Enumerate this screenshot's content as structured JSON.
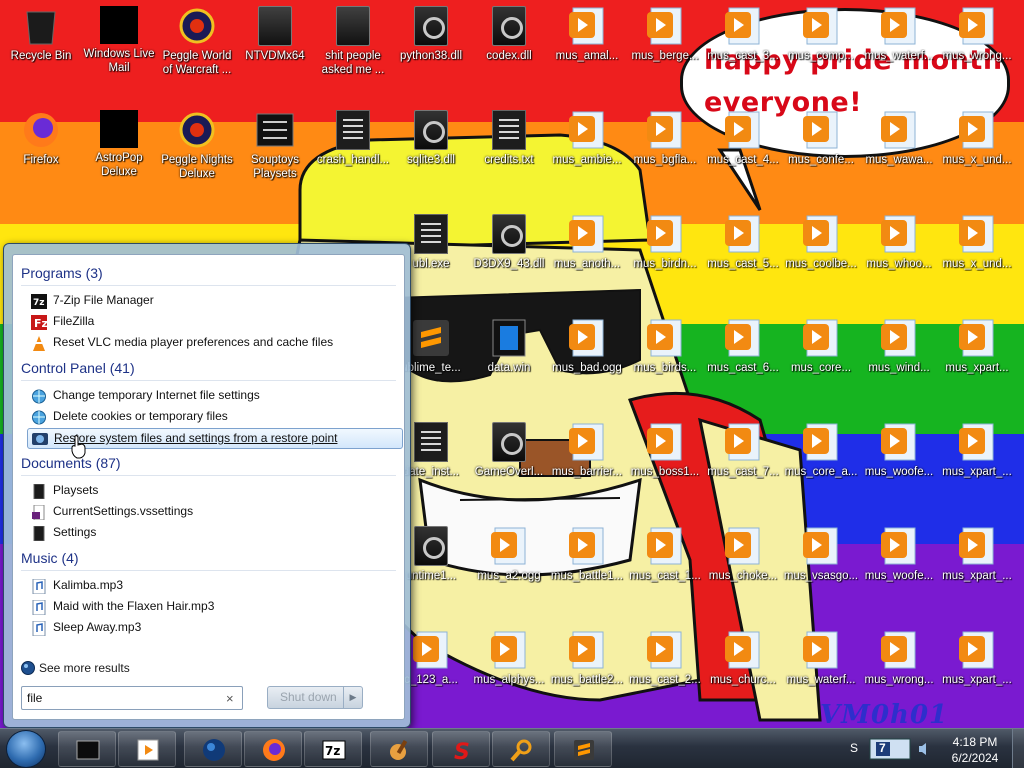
{
  "desktop": {
    "speech_bubble_text": "happy pride month everyone!",
    "watermark_text": "VM0h01",
    "stripe_colors": [
      "#ee1f1f",
      "#ff8a14",
      "#ffe60f",
      "#16b420",
      "#1f2ee8",
      "#7a1ad0"
    ],
    "icons": [
      {
        "label": "Recycle Bin",
        "icon": "recycle-bin-icon"
      },
      {
        "label": "Windows Live Mail",
        "icon": "mail-app-icon"
      },
      {
        "label": "Peggle World of Warcraft ...",
        "icon": "peggle-wow-icon"
      },
      {
        "label": "NTVDMx64",
        "icon": "folder-dark-icon"
      },
      {
        "label": "shit people asked me ...",
        "icon": "folder-file-icon"
      },
      {
        "label": "python38.dll",
        "icon": "dll-file-icon"
      },
      {
        "label": "codex.dll",
        "icon": "dll-file-icon"
      },
      {
        "label": "mus_amal...",
        "icon": "vlc-audio-file-icon"
      },
      {
        "label": "mus_berge...",
        "icon": "vlc-audio-file-icon"
      },
      {
        "label": "mus_cast_3...",
        "icon": "vlc-audio-file-icon"
      },
      {
        "label": "mus_comp...",
        "icon": "vlc-audio-file-icon"
      },
      {
        "label": "mus_waterf...",
        "icon": "vlc-audio-file-icon"
      },
      {
        "label": "mus_wrong...",
        "icon": "vlc-audio-file-icon"
      },
      {
        "label": "Firefox",
        "icon": "firefox-icon"
      },
      {
        "label": "AstroPop Deluxe",
        "icon": "game-shortcut-icon"
      },
      {
        "label": "Peggle Nights Deluxe",
        "icon": "peggle-nights-icon"
      },
      {
        "label": "Souptoys Playsets",
        "icon": "souptoys-icon"
      },
      {
        "label": "crash_handl...",
        "icon": "text-file-icon"
      },
      {
        "label": "sqlite3.dll",
        "icon": "dll-file-icon"
      },
      {
        "label": "credits.txt",
        "icon": "text-file-icon"
      },
      {
        "label": "mus_ambie...",
        "icon": "vlc-audio-file-icon"
      },
      {
        "label": "mus_bgfla...",
        "icon": "vlc-audio-file-icon"
      },
      {
        "label": "mus_cast_4...",
        "icon": "vlc-audio-file-icon"
      },
      {
        "label": "mus_confe...",
        "icon": "vlc-audio-file-icon"
      },
      {
        "label": "mus_wawa...",
        "icon": "vlc-audio-file-icon"
      },
      {
        "label": "mus_x_und...",
        "icon": "vlc-audio-file-icon"
      },
      {
        "label": "ubl.exe",
        "icon": "exe-file-icon"
      },
      {
        "label": "D3DX9_43.dll",
        "icon": "dll-file-icon"
      },
      {
        "label": "mus_anoth...",
        "icon": "vlc-audio-file-icon"
      },
      {
        "label": "mus_birdn...",
        "icon": "vlc-audio-file-icon"
      },
      {
        "label": "mus_cast_5...",
        "icon": "vlc-audio-file-icon"
      },
      {
        "label": "mus_coolbe...",
        "icon": "vlc-audio-file-icon"
      },
      {
        "label": "mus_whoo...",
        "icon": "vlc-audio-file-icon"
      },
      {
        "label": "mus_x_und...",
        "icon": "vlc-audio-file-icon"
      },
      {
        "label": "ublime_te...",
        "icon": "sublime-text-icon"
      },
      {
        "label": "data.win",
        "icon": "data-file-icon"
      },
      {
        "label": "mus_bad.ogg",
        "icon": "vlc-audio-file-icon"
      },
      {
        "label": "mus_birds...",
        "icon": "vlc-audio-file-icon"
      },
      {
        "label": "mus_cast_6...",
        "icon": "vlc-audio-file-icon"
      },
      {
        "label": "mus_core...",
        "icon": "vlc-audio-file-icon"
      },
      {
        "label": "mus_wind...",
        "icon": "vlc-audio-file-icon"
      },
      {
        "label": "mus_xpart...",
        "icon": "vlc-audio-file-icon"
      },
      {
        "label": "date_inst...",
        "icon": "text-file-icon"
      },
      {
        "label": "GameOverl...",
        "icon": "dll-file-icon"
      },
      {
        "label": "mus_barrier...",
        "icon": "vlc-audio-file-icon"
      },
      {
        "label": "mus_boss1...",
        "icon": "vlc-audio-file-icon"
      },
      {
        "label": "mus_cast_7...",
        "icon": "vlc-audio-file-icon"
      },
      {
        "label": "mus_core_a...",
        "icon": "vlc-audio-file-icon"
      },
      {
        "label": "mus_woofe...",
        "icon": "vlc-audio-file-icon"
      },
      {
        "label": "mus_xpart_...",
        "icon": "vlc-audio-file-icon"
      },
      {
        "label": "untime1...",
        "icon": "dll-file-icon"
      },
      {
        "label": "mus_a2.ogg",
        "icon": "vlc-audio-file-icon"
      },
      {
        "label": "mus_battle1...",
        "icon": "vlc-audio-file-icon"
      },
      {
        "label": "mus_cast_1...",
        "icon": "vlc-audio-file-icon"
      },
      {
        "label": "mus_choke...",
        "icon": "vlc-audio-file-icon"
      },
      {
        "label": "mus_vsasgo...",
        "icon": "vlc-audio-file-icon"
      },
      {
        "label": "mus_woofe...",
        "icon": "vlc-audio-file-icon"
      },
      {
        "label": "mus_xpart_...",
        "icon": "vlc-audio-file-icon"
      },
      {
        "label": "c_123_a...",
        "icon": "vlc-audio-file-icon"
      },
      {
        "label": "mus_alphys...",
        "icon": "vlc-audio-file-icon"
      },
      {
        "label": "mus_battle2...",
        "icon": "vlc-audio-file-icon"
      },
      {
        "label": "mus_cast_2...",
        "icon": "vlc-audio-file-icon"
      },
      {
        "label": "mus_churc...",
        "icon": "vlc-audio-file-icon"
      },
      {
        "label": "mus_waterf...",
        "icon": "vlc-audio-file-icon"
      },
      {
        "label": "mus_wrong...",
        "icon": "vlc-audio-file-icon"
      },
      {
        "label": "mus_xpart_...",
        "icon": "vlc-audio-file-icon"
      }
    ]
  },
  "start_menu": {
    "groups": [
      {
        "title": "Programs (3)",
        "items": [
          {
            "label": "7-Zip File Manager",
            "icon": "7zip-icon"
          },
          {
            "label": "FileZilla",
            "icon": "filezilla-icon"
          },
          {
            "label": "Reset VLC media player preferences and cache files",
            "icon": "vlc-cone-icon"
          }
        ]
      },
      {
        "title": "Control Panel (41)",
        "items": [
          {
            "label": "Change temporary Internet file settings",
            "icon": "internet-options-icon"
          },
          {
            "label": "Delete cookies or temporary files",
            "icon": "internet-options-icon"
          },
          {
            "label": "Restore system files and settings from a restore point",
            "icon": "system-restore-icon"
          }
        ]
      },
      {
        "title": "Documents (87)",
        "items": [
          {
            "label": "Playsets",
            "icon": "document-icon"
          },
          {
            "label": "CurrentSettings.vssettings",
            "icon": "vssettings-icon"
          },
          {
            "label": "Settings",
            "icon": "document-icon"
          }
        ]
      },
      {
        "title": "Music (4)",
        "items": [
          {
            "label": "Kalimba.mp3",
            "icon": "music-file-icon"
          },
          {
            "label": "Maid with the Flaxen Hair.mp3",
            "icon": "music-file-icon"
          },
          {
            "label": "Sleep Away.mp3",
            "icon": "music-file-icon"
          }
        ]
      }
    ],
    "highlighted_item": "Restore system files and settings from a restore point",
    "see_more_label": "See more results",
    "search": {
      "value": "file",
      "clear_glyph": "×"
    },
    "shutdown_label": "Shut down",
    "shutdown_arrow": "▶"
  },
  "taskbar": {
    "start_button_icon": "windows-orb-icon",
    "pinned": [
      {
        "name": "taskbar-cmd",
        "icon": "cmd-icon"
      },
      {
        "name": "taskbar-media-player",
        "icon": "media-player-icon"
      },
      {
        "name": "taskbar-ie",
        "icon": "globe-icon"
      },
      {
        "name": "taskbar-firefox",
        "icon": "firefox-icon"
      },
      {
        "name": "taskbar-7zip",
        "icon": "7zip-icon"
      },
      {
        "name": "taskbar-paint",
        "icon": "paint-icon"
      },
      {
        "name": "taskbar-red-s",
        "icon": "red-s-icon"
      },
      {
        "name": "taskbar-search-tool",
        "icon": "magnifier-icon"
      },
      {
        "name": "taskbar-sublime",
        "icon": "sublime-text-icon"
      }
    ],
    "tray_label": "S",
    "tray_badge": "7",
    "clock_time": "4:18 PM",
    "clock_date": "6/2/2024"
  }
}
